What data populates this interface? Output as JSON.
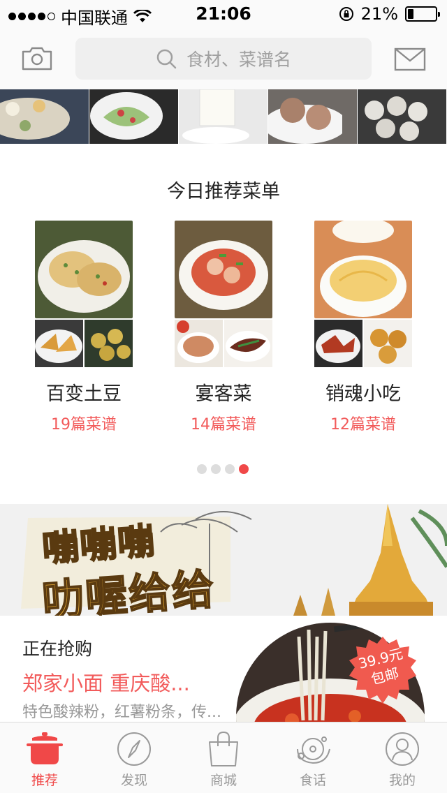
{
  "status_bar": {
    "carrier": "中国联通",
    "time": "21:06",
    "battery_text": "21%",
    "battery_level": 0.21
  },
  "header": {
    "search_placeholder": "食材、菜谱名",
    "icons": {
      "left": "camera-icon",
      "search": "search-icon",
      "right": "mail-icon"
    }
  },
  "section": {
    "title": "今日推荐菜单"
  },
  "menus": [
    {
      "name": "百变土豆",
      "count": "19篇菜谱"
    },
    {
      "name": "宴客菜",
      "count": "14篇菜谱"
    },
    {
      "name": "销魂小吃",
      "count": "12篇菜谱"
    }
  ],
  "pager": {
    "total": 4,
    "active": 4
  },
  "banner": {
    "line1": "嘣嘣嘣",
    "line2": "叻喔给给"
  },
  "flash_sale": {
    "title": "正在抢购",
    "product": "郑家小面  重庆酸...",
    "description": "特色酸辣粉，红薯粉条，传...",
    "price": "39.9元",
    "shipping": "包邮"
  },
  "tabs": [
    {
      "label": "推荐",
      "icon": "pot-icon",
      "active": true
    },
    {
      "label": "发现",
      "icon": "compass-icon",
      "active": false
    },
    {
      "label": "商城",
      "icon": "shopping-bag-icon",
      "active": false
    },
    {
      "label": "食话",
      "icon": "planet-icon",
      "active": false
    },
    {
      "label": "我的",
      "icon": "user-icon",
      "active": false
    }
  ],
  "colors": {
    "accent": "#f04848",
    "count_text": "#f25b5b",
    "inactive_tab": "#9a9a9a"
  }
}
